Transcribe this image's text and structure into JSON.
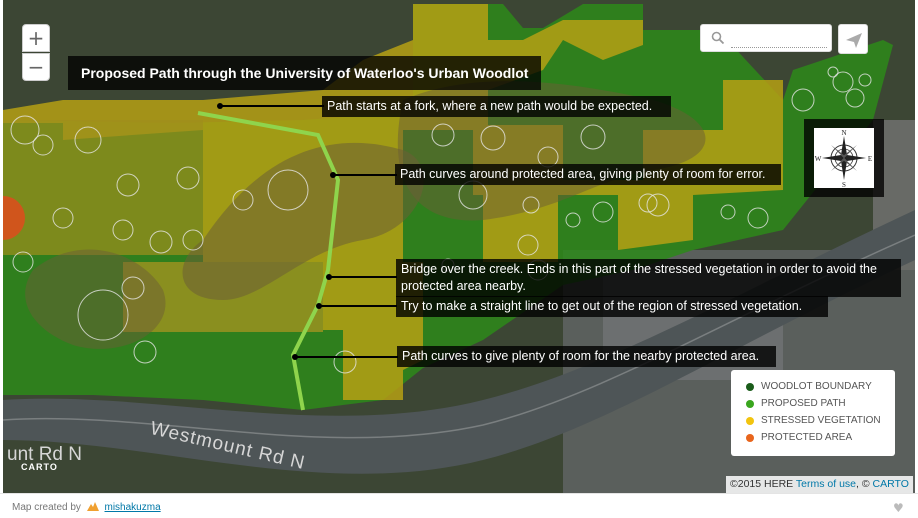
{
  "map": {
    "title": "Proposed Path through the University of Waterloo's Urban Woodlot",
    "zoom_in_label": "+",
    "zoom_out_label": "−",
    "search": {
      "placeholder": ""
    },
    "road_label": "Westmount Rd N",
    "road_label_partial": "unt Rd N",
    "carto_logo": "CARTO",
    "annotations": [
      "Path starts at a fork, where a new path would be expected.",
      "Path curves around protected area, giving plenty of room for error.",
      "Bridge over the creek. Ends in this part of the stressed vegetation in order to avoid the protected area nearby.",
      "Try to make a straight line to get out of the region of stressed vegetation.",
      "Path curves to give plenty of room for the nearby protected area."
    ],
    "legend": {
      "items": [
        {
          "label": "WOODLOT BOUNDARY",
          "color": "#1a5c1a"
        },
        {
          "label": "PROPOSED PATH",
          "color": "#3aa61e"
        },
        {
          "label": "STRESSED VEGETATION",
          "color": "#f2c40f"
        },
        {
          "label": "PROTECTED AREA",
          "color": "#e8651c"
        }
      ]
    },
    "compass": {
      "n": "N",
      "s": "S",
      "e": "E",
      "w": "W"
    },
    "attribution": {
      "prefix": "©2015 HERE",
      "terms_link": "Terms of use",
      "carto_prefix": ", ©",
      "carto_link": "CARTO"
    },
    "colors": {
      "woodlot": "#2f8a1e",
      "stressed": "#b5a014",
      "protected": "#d0551c",
      "path": "#8fd44c"
    }
  },
  "footer": {
    "credit_prefix": "Map created by",
    "credit_user": "mishakuzma",
    "heart_icon": "heart-icon"
  }
}
